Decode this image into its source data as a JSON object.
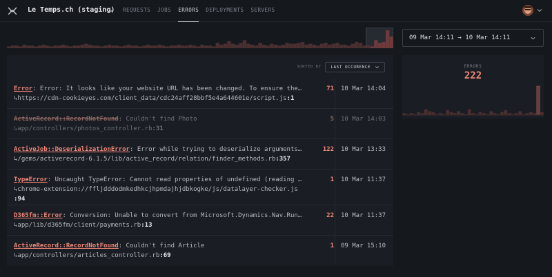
{
  "header": {
    "app_title": "Le Temps.ch (staging)",
    "nav": [
      {
        "label": "REQUESTS",
        "active": false
      },
      {
        "label": "JOBS",
        "active": false
      },
      {
        "label": "ERRORS",
        "active": true
      },
      {
        "label": "DEPLOYMENTS",
        "active": false
      },
      {
        "label": "SERVERS",
        "active": false
      }
    ]
  },
  "date_range": {
    "label": "09 Mar 14:11 → 10 Mar 14:11"
  },
  "sort": {
    "label": "SORTED BY",
    "value": "LAST OCCURENCE"
  },
  "timeline": {
    "values": [
      2,
      3,
      3,
      2,
      4,
      3,
      3,
      2,
      3,
      4,
      3,
      2,
      3,
      3,
      4,
      3,
      2,
      3,
      3,
      4,
      5,
      4,
      3,
      3,
      2,
      3,
      4,
      3,
      3,
      2,
      3,
      4,
      3,
      3,
      2,
      3,
      4,
      3,
      3,
      4,
      3,
      2,
      3,
      3,
      4,
      3,
      3,
      4,
      3,
      2,
      4,
      3,
      3,
      2,
      6,
      4,
      5,
      8,
      5,
      4,
      6,
      9,
      5,
      4,
      3,
      6,
      4,
      3,
      5,
      4,
      3,
      4,
      6,
      5,
      5,
      6,
      7,
      4,
      5,
      4,
      3,
      5,
      6,
      4,
      5,
      6,
      4,
      4,
      3,
      5,
      7,
      6,
      3,
      4,
      2,
      9,
      6,
      7,
      20,
      13
    ],
    "selection_start_fraction": 0.93
  },
  "errors": [
    {
      "class": "Error",
      "message": ": Error: It looks like your website URL has been changed. To ensure the…",
      "location": "↳https://cdn-cookieyes.com/client_data/cdc24aff28bbf5e4a644601e/script.js",
      "line": ":1",
      "count": "71",
      "last": "10 Mar 14:04",
      "resolved": false
    },
    {
      "class": "ActiveRecord::RecordNotFound",
      "message": ": Couldn't find Photo",
      "location": "↳app/controllers/photos_controller.rb",
      "line": ":31",
      "count": "5",
      "last": "10 Mar 14:03",
      "resolved": true
    },
    {
      "class": "ActiveJob::DeserializationError",
      "message": ": Error while trying to deserialize arguments…",
      "location": "↳/gems/activerecord-6.1.5/lib/active_record/relation/finder_methods.rb",
      "line": ":357",
      "count": "122",
      "last": "10 Mar 13:33",
      "resolved": false
    },
    {
      "class": "TypeError",
      "message": ": Uncaught TypeError: Cannot read properties of undefined (reading …",
      "location": "↳chrome-extension://ffljdddodmkedhkcjhpmdajhjdbkogke/js/datalayer-checker.js",
      "line": ":94",
      "count": "1",
      "last": "10 Mar 11:37",
      "resolved": false
    },
    {
      "class": "D365fm::Error",
      "message": ": Conversion: Unable to convert from Microsoft.Dynamics.Nav.Run…",
      "location": "↳app/lib/d365fm/client/payments.rb",
      "line": ":13",
      "count": "22",
      "last": "10 Mar 11:37",
      "resolved": false
    },
    {
      "class": "ActiveRecord::RecordNotFound",
      "message": ": Couldn't find Article",
      "location": "↳app/controllers/articles_controller.rb",
      "line": ":69",
      "count": "1",
      "last": "09 Mar 15:10",
      "resolved": false
    }
  ],
  "stats": {
    "label": "ERRORS",
    "value": "222",
    "bars": [
      2,
      1,
      2,
      1,
      3,
      2,
      6,
      4,
      3,
      1,
      2,
      1,
      5,
      3,
      2,
      4,
      2,
      1,
      6,
      2,
      1,
      3,
      2,
      1,
      4,
      2,
      1,
      3,
      5,
      2,
      1,
      2,
      4,
      1,
      2,
      3,
      2,
      30,
      3
    ]
  },
  "colors": {
    "accent": "#f0877a",
    "bar": "#4a2f30",
    "bar_highlight": "#6e3b3d",
    "background": "#15181d",
    "panel": "#1a1e24"
  }
}
